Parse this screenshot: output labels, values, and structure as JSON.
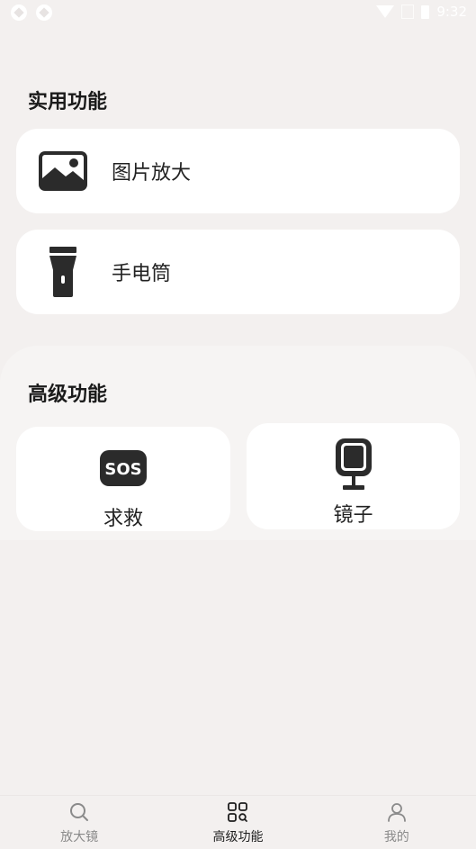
{
  "status_bar": {
    "time": "9:32"
  },
  "utility": {
    "title": "实用功能",
    "items": [
      {
        "label": "图片放大",
        "icon": "image-icon"
      },
      {
        "label": "手电筒",
        "icon": "flashlight-icon"
      }
    ]
  },
  "advanced": {
    "title": "高级功能",
    "items": [
      {
        "label": "求救",
        "icon": "sos-icon"
      },
      {
        "label": "镜子",
        "icon": "mirror-icon"
      }
    ]
  },
  "bottom_nav": {
    "items": [
      {
        "label": "放大镜",
        "icon": "search-icon",
        "active": false
      },
      {
        "label": "高级功能",
        "icon": "grid-icon",
        "active": true
      },
      {
        "label": "我的",
        "icon": "user-icon",
        "active": false
      }
    ]
  },
  "colors": {
    "background": "#f3f0ef",
    "card": "#ffffff",
    "icon": "#2b2b2b",
    "nav_inactive": "#8a8a8a"
  }
}
